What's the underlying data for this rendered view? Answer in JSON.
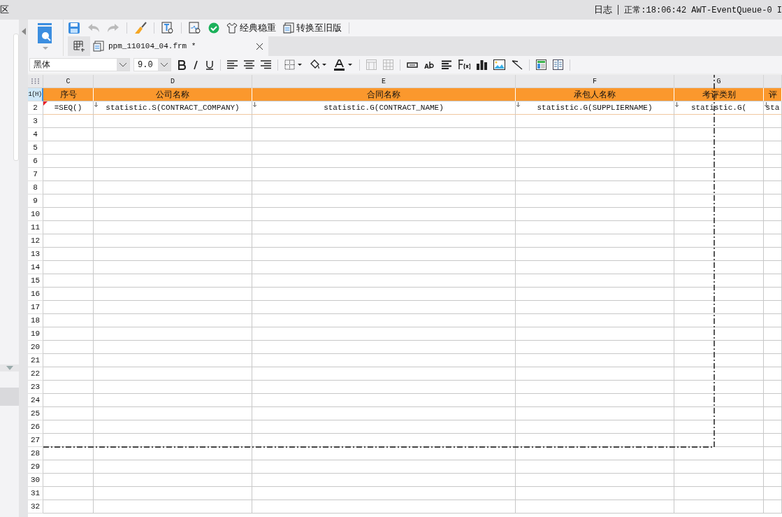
{
  "top_bar": {
    "left_text": "区",
    "log_label": "日志",
    "status_text": "正常:18:06:42 AWT-EventQueue-0 I"
  },
  "toolbar": {
    "theme_label": "经典稳重",
    "convert_label": "转换至旧版"
  },
  "tabs": [
    {
      "label": "ppm_110104_04.frm *",
      "selected": true
    }
  ],
  "format_bar": {
    "font": "黑体",
    "size": "9.0"
  },
  "sheet": {
    "columns": [
      "C",
      "D",
      "E",
      "F",
      "G",
      ""
    ],
    "header_row": {
      "label": "1(H)",
      "cells": [
        "序号",
        "公司名称",
        "合同名称",
        "承包人名称",
        "考评类别",
        "评"
      ]
    },
    "formula_row": {
      "label": "2",
      "cells": [
        "=SEQ()",
        "statistic.S(CONTRACT_COMPANY)",
        "statistic.G(CONTRACT_NAME)",
        "statistic.G(SUPPLIERNAME)",
        "statistic.G(",
        "sta"
      ]
    },
    "rows": [
      "3",
      "4",
      "5",
      "6",
      "7",
      "8",
      "9",
      "10",
      "11",
      "12",
      "13",
      "14",
      "15",
      "16",
      "17",
      "18",
      "19",
      "20",
      "21",
      "22",
      "23",
      "24",
      "25",
      "26",
      "27",
      "28",
      "29",
      "30",
      "31",
      "32"
    ]
  }
}
